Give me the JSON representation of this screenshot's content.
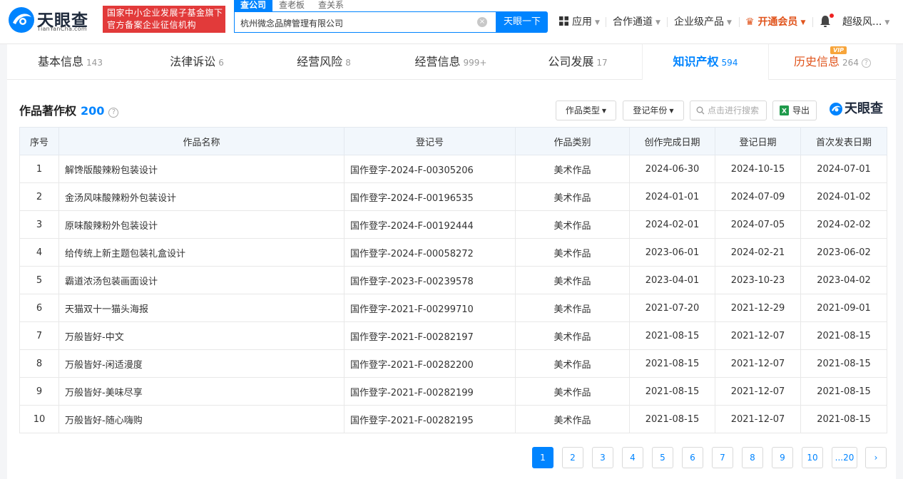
{
  "header": {
    "logo_text": "天眼查",
    "logo_sub": "TianYanCha.com",
    "badge_line1": "国家中小企业发展子基金旗下",
    "badge_line2": "官方备案企业征信机构",
    "search_tabs": [
      "查公司",
      "查老板",
      "查关系"
    ],
    "search_value": "杭州微念品牌管理有限公司",
    "search_button": "天眼一下",
    "nav": {
      "apps": "应用",
      "channel": "合作通道",
      "enterprise": "企业级产品",
      "vip": "开通会员",
      "user": "超级风..."
    }
  },
  "tabs": [
    {
      "label": "基本信息",
      "count": "143"
    },
    {
      "label": "法律诉讼",
      "count": "6"
    },
    {
      "label": "经营风险",
      "count": "8"
    },
    {
      "label": "经营信息",
      "count": "999+"
    },
    {
      "label": "公司发展",
      "count": "17"
    },
    {
      "label": "知识产权",
      "count": "594"
    },
    {
      "label": "历史信息",
      "count": "264"
    }
  ],
  "vip_tag": "VIP",
  "section": {
    "title": "作品著作权",
    "count": "200",
    "filter_type": "作品类型",
    "filter_year": "登记年份",
    "search_placeholder": "点击进行搜索",
    "export": "导出",
    "watermark": "天眼查"
  },
  "table": {
    "headers": [
      "序号",
      "作品名称",
      "登记号",
      "作品类别",
      "创作完成日期",
      "登记日期",
      "首次发表日期"
    ],
    "rows": [
      [
        "1",
        "解馋版酸辣粉包装设计",
        "国作登字-2024-F-00305206",
        "美术作品",
        "2024-06-30",
        "2024-10-15",
        "2024-07-01"
      ],
      [
        "2",
        "金汤风味酸辣粉外包装设计",
        "国作登字-2024-F-00196535",
        "美术作品",
        "2024-01-01",
        "2024-07-09",
        "2024-01-02"
      ],
      [
        "3",
        "原味酸辣粉外包装设计",
        "国作登字-2024-F-00192444",
        "美术作品",
        "2024-02-01",
        "2024-07-05",
        "2024-02-02"
      ],
      [
        "4",
        "给传统上新主题包装礼盒设计",
        "国作登字-2024-F-00058272",
        "美术作品",
        "2023-06-01",
        "2024-02-21",
        "2023-06-02"
      ],
      [
        "5",
        "霸道浓汤包装画面设计",
        "国作登字-2023-F-00239578",
        "美术作品",
        "2023-04-01",
        "2023-10-23",
        "2023-04-02"
      ],
      [
        "6",
        "天猫双十一猫头海报",
        "国作登字-2021-F-00299710",
        "美术作品",
        "2021-07-20",
        "2021-12-29",
        "2021-09-01"
      ],
      [
        "7",
        "万般皆好-中文",
        "国作登字-2021-F-00282197",
        "美术作品",
        "2021-08-15",
        "2021-12-07",
        "2021-08-15"
      ],
      [
        "8",
        "万般皆好-闲适漫度",
        "国作登字-2021-F-00282200",
        "美术作品",
        "2021-08-15",
        "2021-12-07",
        "2021-08-15"
      ],
      [
        "9",
        "万般皆好-美味尽享",
        "国作登字-2021-F-00282199",
        "美术作品",
        "2021-08-15",
        "2021-12-07",
        "2021-08-15"
      ],
      [
        "10",
        "万般皆好-随心嗨购",
        "国作登字-2021-F-00282195",
        "美术作品",
        "2021-08-15",
        "2021-12-07",
        "2021-08-15"
      ]
    ]
  },
  "pagination": {
    "pages": [
      "1",
      "2",
      "3",
      "4",
      "5",
      "6",
      "7",
      "8",
      "9",
      "10",
      "...20"
    ],
    "current": "1",
    "next": "›"
  },
  "colors": {
    "accent": "#0084ff",
    "badge_red": "#e23a3a",
    "vip_orange": "#e0541c"
  }
}
